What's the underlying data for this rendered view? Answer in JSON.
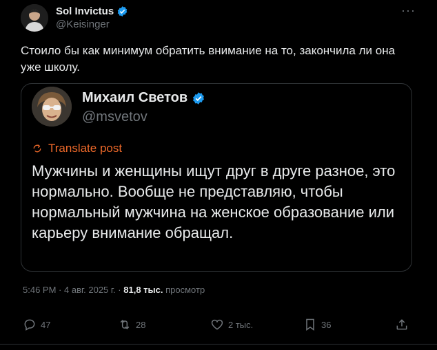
{
  "author": {
    "name": "Sol Invictus",
    "handle": "@Keisinger"
  },
  "more_icon": "more-horizontal-icon",
  "tweet_text": "Стоило бы как минимум обратить внимание на то, закончила ли она уже школу.",
  "quote": {
    "name": "Михаил Светов",
    "handle": "@msvetov",
    "translate_label": "Translate post",
    "text": "Мужчины и женщины ищут друг в друге разное, это нормально. Вообще не представляю, чтобы нормальный мужчина на женское образование или карьеру внимание обращал."
  },
  "meta": {
    "time": "5:46 PM",
    "date": "4 авг. 2025 г.",
    "separator": "·",
    "views_count": "81,8 тыс.",
    "views_label": "просмотр"
  },
  "actions": {
    "replies": "47",
    "reposts": "28",
    "likes": "2 тыс.",
    "bookmarks": "36"
  },
  "colors": {
    "background": "#000000",
    "text": "#e7e9ea",
    "secondary": "#71767b",
    "verified": "#1d9bf0",
    "translate": "#f06a2a",
    "border": "#2f3336"
  }
}
